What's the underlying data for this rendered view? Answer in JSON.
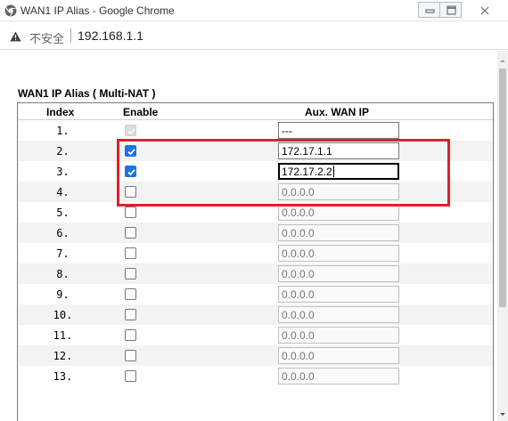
{
  "window": {
    "title": "WAN1 IP Alias - Google Chrome",
    "icon": "chrome-icon"
  },
  "address_bar": {
    "security_icon": "warning-triangle-icon",
    "security_label": "不安全",
    "url": "192.168.1.1"
  },
  "section": {
    "title": "WAN1 IP Alias ( Multi-NAT )"
  },
  "table": {
    "headers": {
      "index": "Index",
      "enable": "Enable",
      "aux_wan_ip": "Aux. WAN IP"
    },
    "rows": [
      {
        "index": "1.",
        "enabled": true,
        "disabled": true,
        "ip": "---",
        "ip_active": true
      },
      {
        "index": "2.",
        "enabled": true,
        "disabled": false,
        "ip": "172.17.1.1",
        "ip_active": true
      },
      {
        "index": "3.",
        "enabled": true,
        "disabled": false,
        "ip": "172.17.2.2",
        "ip_active": true,
        "focused": true
      },
      {
        "index": "4.",
        "enabled": false,
        "disabled": false,
        "ip": "0.0.0.0",
        "ip_active": false
      },
      {
        "index": "5.",
        "enabled": false,
        "disabled": false,
        "ip": "0.0.0.0",
        "ip_active": false
      },
      {
        "index": "6.",
        "enabled": false,
        "disabled": false,
        "ip": "0.0.0.0",
        "ip_active": false
      },
      {
        "index": "7.",
        "enabled": false,
        "disabled": false,
        "ip": "0.0.0.0",
        "ip_active": false
      },
      {
        "index": "8.",
        "enabled": false,
        "disabled": false,
        "ip": "0.0.0.0",
        "ip_active": false
      },
      {
        "index": "9.",
        "enabled": false,
        "disabled": false,
        "ip": "0.0.0.0",
        "ip_active": false
      },
      {
        "index": "10.",
        "enabled": false,
        "disabled": false,
        "ip": "0.0.0.0",
        "ip_active": false
      },
      {
        "index": "11.",
        "enabled": false,
        "disabled": false,
        "ip": "0.0.0.0",
        "ip_active": false
      },
      {
        "index": "12.",
        "enabled": false,
        "disabled": false,
        "ip": "0.0.0.0",
        "ip_active": false
      },
      {
        "index": "13.",
        "enabled": false,
        "disabled": false,
        "ip": "0.0.0.0",
        "ip_active": false
      }
    ]
  },
  "colors": {
    "highlight": "#e0202a",
    "checkbox_checked": "#1a73e8"
  }
}
